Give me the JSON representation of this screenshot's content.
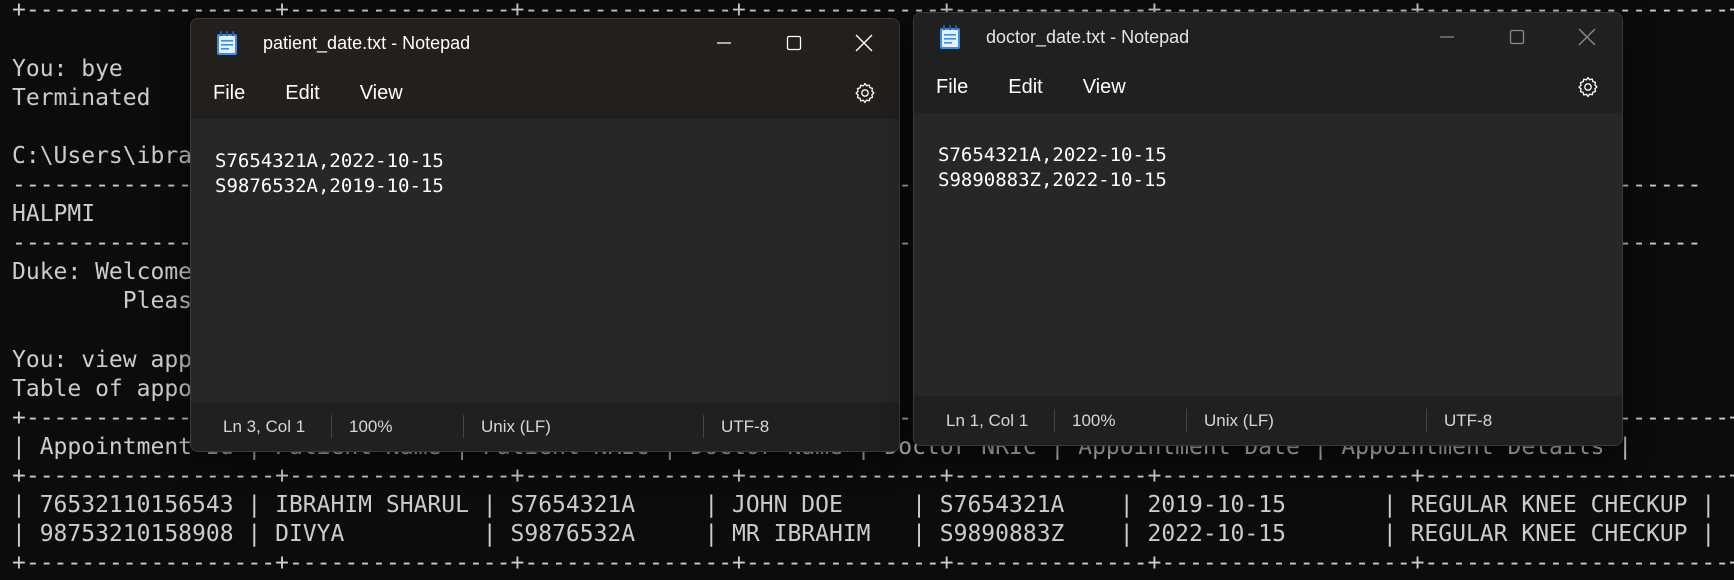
{
  "terminal": {
    "lines": [
      "+------------------+----------------+---------------+--------------+--------------+------------------+----------------------+",
      "",
      "You: bye",
      "Terminated",
      "",
      "C:\\Users\\ibrahim>",
      "--------------------------------------------------------------------------------------------------------------------------",
      "HALPMI",
      "--------------------------------------------------------------------------------------------------------------------------",
      "Duke: Welcome",
      "        Please",
      "",
      "You: view appointments",
      "Table of appointments",
      "+------------------+----------------+---------------+--------------+--------------+------------------+----------------------+",
      "| Appointment Id | Patient Name | Patient NRIC | Doctor Name | Doctor NRIC | Appointment Date | Appointment Details |",
      "+------------------+----------------+---------------+--------------+--------------+------------------+----------------------+",
      "| 76532110156543 | IBRAHIM SHARUL | S7654321A     | JOHN DOE     | S7654321A    | 2019-10-15       | REGULAR KNEE CHECKUP |",
      "| 98753210158908 | DIVYA          | S9876532A     | MR IBRAHIM   | S9890883Z    | 2022-10-15       | REGULAR KNEE CHECKUP |",
      "+------------------+----------------+---------------+--------------+--------------+------------------+----------------------+"
    ]
  },
  "notepad_patient": {
    "title": "patient_date.txt - Notepad",
    "menu": [
      "File",
      "Edit",
      "View"
    ],
    "content": [
      "S7654321A,2022-10-15",
      "S9876532A,2019-10-15"
    ],
    "status": {
      "position": "Ln 3, Col 1",
      "zoom": "100%",
      "line_ending": "Unix (LF)",
      "encoding": "UTF-8"
    }
  },
  "notepad_doctor": {
    "title": "doctor_date.txt - Notepad",
    "menu": [
      "File",
      "Edit",
      "View"
    ],
    "content": [
      "S7654321A,2022-10-15",
      "S9890883Z,2022-10-15"
    ],
    "status": {
      "position": "Ln 1, Col 1",
      "zoom": "100%",
      "line_ending": "Unix (LF)",
      "encoding": "UTF-8"
    }
  },
  "icons": {
    "app": "notepad-icon",
    "minimize": "minimize-icon",
    "maximize": "maximize-icon",
    "close": "close-icon",
    "settings": "gear-icon"
  },
  "colors": {
    "terminal_bg": "#0c0c0c",
    "terminal_fg": "#cccccc",
    "notepad_bg": "#272727",
    "notepad_chrome": "#202020"
  }
}
